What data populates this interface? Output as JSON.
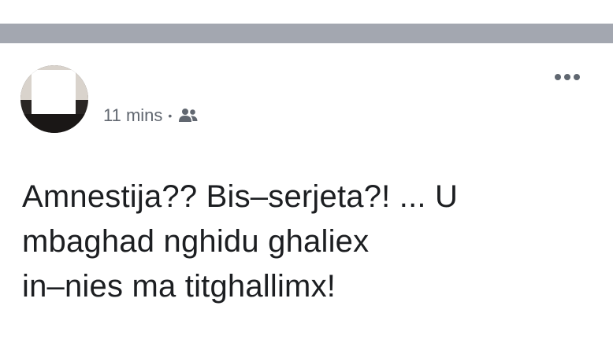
{
  "post": {
    "timestamp": "11 mins",
    "separator": "•",
    "audience_icon": "friends-icon",
    "menu_icon": "more-options-icon",
    "text_lines": [
      "Amnestija?? Bis–serjeta?! ... U",
      "mbaghad nghidu ghaliex",
      "in–nies ma titghallimx!"
    ]
  },
  "colors": {
    "divider_bar": "#a3a7b0",
    "meta_text": "#616770",
    "body_text": "#1c1e21"
  }
}
